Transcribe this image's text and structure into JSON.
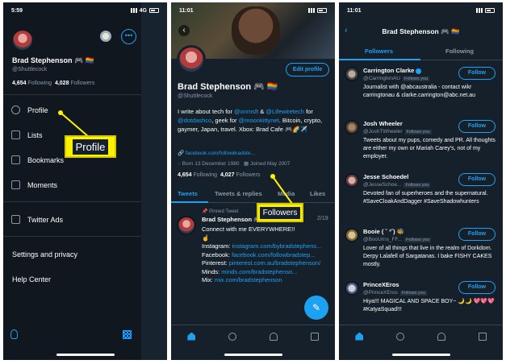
{
  "panel1": {
    "status": {
      "time": "5:59",
      "signal": "4G"
    },
    "more_glyph": "•••",
    "profile": {
      "name": "Brad Stephenson 🎮 🏳️‍🌈",
      "handle": "@Shuttlecock",
      "following_count": "4,654",
      "following_label": "Following",
      "followers_count": "4,028",
      "followers_label": "Followers"
    },
    "menu": [
      {
        "label": "Profile",
        "icon": "person-icon"
      },
      {
        "label": "Lists",
        "icon": "list-icon"
      },
      {
        "label": "Bookmarks",
        "icon": "bookmark-icon"
      },
      {
        "label": "Moments",
        "icon": "lightning-icon"
      },
      {
        "label": "Twitter Ads",
        "icon": "external-arrow-icon"
      }
    ],
    "settings_label": "Settings and privacy",
    "help_label": "Help Center",
    "callout": "Profile"
  },
  "panel2": {
    "status": {
      "time": "11:01"
    },
    "edit_label": "Edit profile",
    "back_glyph": "‹",
    "profile": {
      "name": "Brad Stephenson 🎮 🏳️‍🌈",
      "handle": "@Shuttlecock",
      "bio_1": "I write about tech for ",
      "bio_link_1": "@onmsft",
      "bio_2": " & ",
      "bio_link_2": "@Lifewiretech",
      "bio_3": " for ",
      "bio_link_3": "@dotdashco",
      "bio_4": ", geek for ",
      "bio_link_4": "@moonkittynet",
      "bio_5": ". Bitcoin, crypto, gaymer, Japan, travel. Xbox: Brad Cafe 🎮🌈✈️",
      "website": "facebook.com/followbradste...",
      "born": "Born 13 December 1980",
      "joined": "Joined May 2007",
      "following_count": "4,654",
      "following_label": "Following",
      "followers_count": "4,027",
      "followers_label": "Followers"
    },
    "tabs": [
      "Tweets",
      "Tweets & replies",
      "Media",
      "Likes"
    ],
    "pinned_label": "Pinned Tweet",
    "tweet": {
      "author": "Brad Stephenson 🎮",
      "date": "2/19",
      "line1": "Connect with me EVERYWHERE!!",
      "point_glyph": "☝️",
      "ig_label": "Instagram: ",
      "ig_link": "instagram.com/bybradstephens...",
      "fb_label": "Facebook: ",
      "fb_link": "facebook.com/followbradstep...",
      "pin_label": "Pinterest: ",
      "pin_link": "pinterest.com.au/bradstephenson/",
      "minds_label": "Minds: ",
      "minds_link": "minds.com/bradstephenso...",
      "mix_label": "Mix: ",
      "mix_link": "mix.com/bradstephenson"
    },
    "fab_glyph": "✎",
    "callout": "Followers"
  },
  "panel3": {
    "status": {
      "time": "11:01"
    },
    "back_glyph": "‹",
    "title": "Brad Stephenson 🎮 🏳️‍🌈",
    "tabs": [
      "Followers",
      "Following"
    ],
    "follow_label": "Follow",
    "follows_you": "Follows you",
    "followers": [
      {
        "name": "Carrington Clarke",
        "handle": "@CarringtonAU",
        "bio": "Journalist with @abcaustralia - contact wikr carringtonau & clarke.carrington@abc.net.au"
      },
      {
        "name": "Josh Wheeler",
        "handle": "@JoshTWheeler",
        "bio": "Tweets about my pups, comedy and PR. All thoughts are either my own or Mariah Carey's, not of my employer."
      },
      {
        "name": "Jesse Schoedel",
        "handle": "@JesseSchoe...",
        "bio": "Devoted fan of superheroes and the supernatural. #SaveCloakAndDagger #SaveShadowhunters"
      },
      {
        "name": "Booie ( ˘ ³˘) 🐝",
        "handle": "@BooUrns_FF...",
        "bio": "Lover of all things that live in the realm of Dorkdom. Derpy Lalafell of Sargatanas. I bake FISHY CAKES mostly."
      },
      {
        "name": "PrinceXEros",
        "handle": "@PrinceXEros",
        "bio": "Hiya!!! MAGICAL AND SPACE BOY~ 🌙🌙 💖💖💖 #KatyaSquad!!!"
      }
    ]
  }
}
